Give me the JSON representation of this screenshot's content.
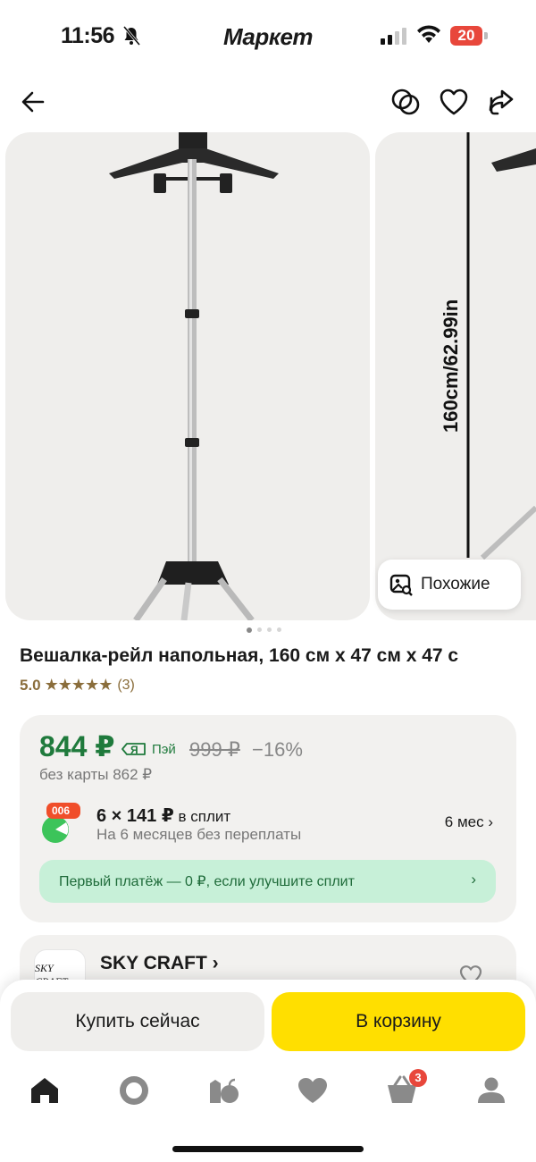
{
  "status_bar": {
    "time": "11:56",
    "app_name": "Маркет",
    "battery": "20"
  },
  "gallery": {
    "similar_label": "Похожие",
    "photo2_dimension": "160cm/62.99in",
    "dots_count": 4,
    "active_dot": 0
  },
  "product": {
    "title": "Вешалка-рейл напольная, 160 см х 47 см х 47 с",
    "rating": "5.0",
    "stars": "★★★★★",
    "reviews": "(3)"
  },
  "price": {
    "current": "844 ₽",
    "pay_label": "Пэй",
    "old": "999 ₽",
    "discount": "−16%",
    "no_card": "без карты 862 ₽"
  },
  "split": {
    "logo_text": "006",
    "title": "6 × 141 ₽",
    "title_suffix": " в сплит",
    "subtitle": "На 6 месяцев без переплаты",
    "term": "6 мес ›",
    "banner": "Первый платёж — 0 ₽, если улучшите сплит",
    "banner_chevron": "›"
  },
  "shop": {
    "name": "SKY CRAFT ›",
    "logo_text": "SKY CRAFT"
  },
  "actions": {
    "buy_now": "Купить сейчас",
    "add_to_cart": "В корзину"
  },
  "tabbar": {
    "cart_count": "3"
  },
  "colors": {
    "accent_yellow": "#ffdf00",
    "price_green": "#1f7a3c",
    "badge_red": "#e8473b",
    "split_banner": "#c7f0d8"
  }
}
